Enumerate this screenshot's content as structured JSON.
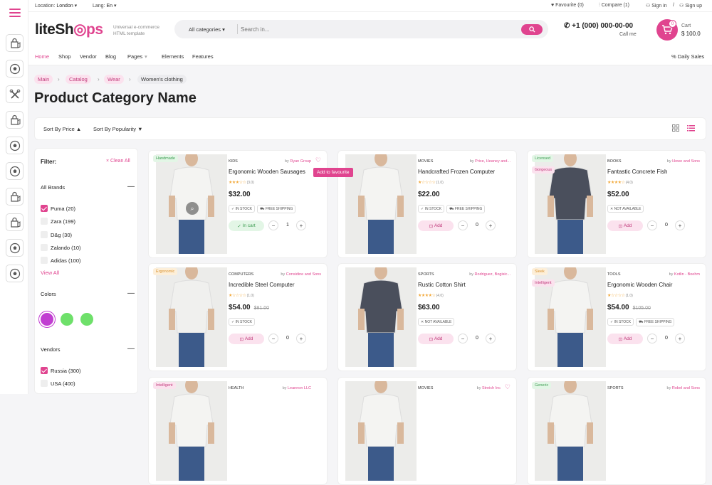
{
  "topbar": {
    "location_label": "Location:",
    "location_value": "London",
    "lang_label": "Lang:",
    "lang_value": "En",
    "favourite": "Favourite (0)",
    "compare": "Compare (1)",
    "sign_in": "Sign in",
    "separator": "/",
    "sign_up": "Sign up"
  },
  "header": {
    "logo_part1": "liteSh",
    "logo_part2": "ps",
    "tagline_1": "Universal e-commerce",
    "tagline_2": "HTML template",
    "category_select": "All categories",
    "search_placeholder": "Search in...",
    "phone": "+1 (000) 000-00-00",
    "call_me": "Call me",
    "cart_label": "Cart",
    "cart_total": "$ 100.0",
    "cart_count": "0"
  },
  "nav": {
    "items": [
      "Home",
      "Shop",
      "Vendor",
      "Blog",
      "Pages",
      "Elements",
      "Features"
    ],
    "daily_sales": "Daily Sales"
  },
  "breadcrumb": [
    "Main",
    "Catalog",
    "Wear",
    "Women's clothing"
  ],
  "page_title": "Product Category Name",
  "sort": {
    "by_price": "Sort By Price",
    "by_popularity": "Sort By Popularity"
  },
  "filter": {
    "title": "Filter:",
    "clear_all": "Clean All",
    "brands_title": "All Brands",
    "brands": [
      {
        "label": "Puma (20)",
        "checked": true
      },
      {
        "label": "Zara (199)",
        "checked": false
      },
      {
        "label": "D&g (30)",
        "checked": false
      },
      {
        "label": "Zalando (10)",
        "checked": false
      },
      {
        "label": "Adidas (100)",
        "checked": false
      }
    ],
    "view_all": "View All",
    "colors_title": "Colors",
    "colors": [
      "#c13ed1",
      "#6ee06a",
      "#6ee06a"
    ],
    "vendors_title": "Vendors",
    "vendors": [
      {
        "label": "Russia (300)",
        "checked": true
      },
      {
        "label": "USA (400)",
        "checked": false
      }
    ]
  },
  "tooltip": "Add to favourite",
  "products": [
    {
      "badges": [
        "Handmade"
      ],
      "category": "KIDS",
      "by": "by",
      "vendor": "Ryan Group",
      "name": "Ergonomic Wooden Sausages",
      "rating": 3,
      "reviews": "(3.0)",
      "price": "$32.00",
      "old_price": "",
      "tags": [
        "IN STOCK",
        "FREE SHIPPING"
      ],
      "button": "In cart",
      "qty": "1"
    },
    {
      "badges": [],
      "category": "MOVIES",
      "by": "by",
      "vendor": "Price, Heaney and...",
      "name": "Handcrafted Frozen Computer",
      "rating": 1,
      "reviews": "(1.0)",
      "price": "$22.00",
      "old_price": "",
      "tags": [
        "IN STOCK",
        "FREE SHIPPING"
      ],
      "button": "Add",
      "qty": "0"
    },
    {
      "badges": [
        "Licensed",
        "Gorgeous"
      ],
      "category": "BOOKS",
      "by": "by",
      "vendor": "Howe and Sons",
      "name": "Fantastic Concrete Fish",
      "rating": 4,
      "reviews": "(4.0)",
      "price": "$52.00",
      "old_price": "",
      "tags": [
        "NOT AVAILABLE"
      ],
      "button": "Add",
      "qty": "0"
    },
    {
      "badges": [
        "Ergonomic"
      ],
      "category": "COMPUTERS",
      "by": "by",
      "vendor": "Considine and Sons",
      "name": "Incredible Steel Computer",
      "rating": 1,
      "reviews": "(1.0)",
      "price": "$54.00",
      "old_price": "$81.00",
      "tags": [
        "IN STOCK"
      ],
      "button": "Add",
      "qty": "0"
    },
    {
      "badges": [],
      "category": "SPORTS",
      "by": "by",
      "vendor": "Rodriguez, Bogisic...",
      "name": "Rustic Cotton Shirt",
      "rating": 4,
      "reviews": "(4.0)",
      "price": "$63.00",
      "old_price": "",
      "tags": [
        "NOT AVAILABLE"
      ],
      "button": "Add",
      "qty": "0"
    },
    {
      "badges": [
        "Sleek",
        "Intelligent"
      ],
      "category": "TOOLS",
      "by": "by",
      "vendor": "Kotlin - Boehm",
      "name": "Ergonomic Wooden Chair",
      "rating": 1,
      "reviews": "(1.0)",
      "price": "$54.00",
      "old_price": "$105.00",
      "tags": [
        "IN STOCK",
        "FREE SHIPPING"
      ],
      "button": "Add",
      "qty": "0"
    },
    {
      "badges": [
        "Intelligent"
      ],
      "category": "HEALTH",
      "by": "by",
      "vendor": "Leannon LLC",
      "name": "",
      "rating": 0,
      "reviews": "",
      "price": "",
      "old_price": "",
      "tags": [],
      "button": "",
      "qty": ""
    },
    {
      "badges": [],
      "category": "MOVIES",
      "by": "by",
      "vendor": "Streich Inc",
      "name": "",
      "rating": 0,
      "reviews": "",
      "price": "",
      "old_price": "",
      "tags": [],
      "button": "",
      "qty": ""
    },
    {
      "badges": [
        "Generic"
      ],
      "category": "SPORTS",
      "by": "by",
      "vendor": "Robel and Sons",
      "name": "",
      "rating": 0,
      "reviews": "",
      "price": "",
      "old_price": "",
      "tags": [],
      "button": "",
      "qty": ""
    }
  ]
}
